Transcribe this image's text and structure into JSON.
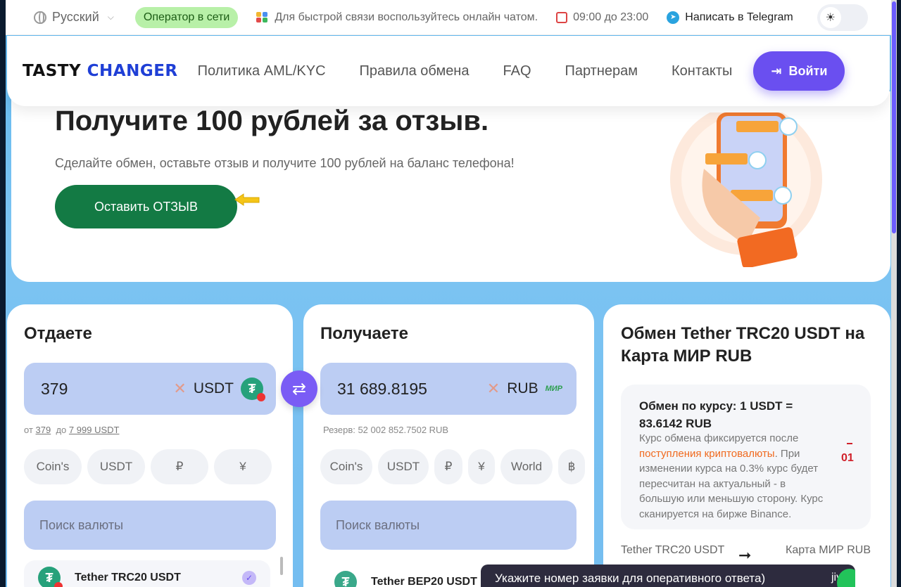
{
  "topbar": {
    "language": "Русский",
    "online_status": "Оператор в сети",
    "chat_note": "Для быстрой связи воспользуйтесь онлайн чатом.",
    "hours": "09:00 до 23:00",
    "telegram": "Написать в Telegram"
  },
  "nav": {
    "logo_part1": "TASTY",
    "logo_part2": "CHANGER",
    "links": [
      "Политика AML/KYC",
      "Правила обмена",
      "FAQ",
      "Партнерам",
      "Контакты"
    ],
    "login": "Войти"
  },
  "banner": {
    "title": "Получите 100 рублей за отзыв.",
    "subtitle": "Сделайте обмен, оставьте отзыв и получите 100 рублей на баланс телефона!",
    "button": "Оставить ОТЗЫВ"
  },
  "give": {
    "heading": "Отдаете",
    "amount": "379",
    "currency": "USDT",
    "limit_from_label": "от",
    "limit_from": "379",
    "limit_to_label": "до",
    "limit_to": "7 999 USDT",
    "chips": [
      "Coin's",
      "USDT",
      "₽",
      "¥"
    ],
    "search_placeholder": "Поиск валюты",
    "list_item": "Tether TRC20 USDT"
  },
  "get": {
    "heading": "Получаете",
    "amount": "31 689.8195",
    "currency": "RUB",
    "currency_logo": "МИР",
    "reserve": "Резерв: 52 002 852.7502 RUB",
    "chips": [
      "Coin's",
      "USDT",
      "₽",
      "¥",
      "World",
      "฿"
    ],
    "search_placeholder": "Поиск валюты",
    "list_item": "Tether BEP20 USDT"
  },
  "info": {
    "heading": "Обмен Tether TRC20 USDT на Карта МИР RUB",
    "rate_title": "Обмен по курсу: 1 USDT = 83.6142 RUB",
    "rate_desc_1": "Курс обмена фиксируется после ",
    "rate_desc_highlight": "поступления криптовалюты",
    "rate_desc_2": ". При изменении курса на 0.3% курс будет пересчитан на актуальный - в большую или меньшую сторону. Курс сканируется на бирже Binance.",
    "timer": "01",
    "pair_from": "Tether TRC20 USDT",
    "pair_to": "Карта МИР RUB"
  },
  "toast": {
    "text": "Укажите номер заявки для оперативного ответа)",
    "brand": "jivo"
  },
  "colors": {
    "accent": "#6a4ff0",
    "brand_blue": "#1f3fd6",
    "review_green": "#137a44",
    "input_bg": "#bccdf3",
    "highlight_orange": "#f06a1f"
  }
}
